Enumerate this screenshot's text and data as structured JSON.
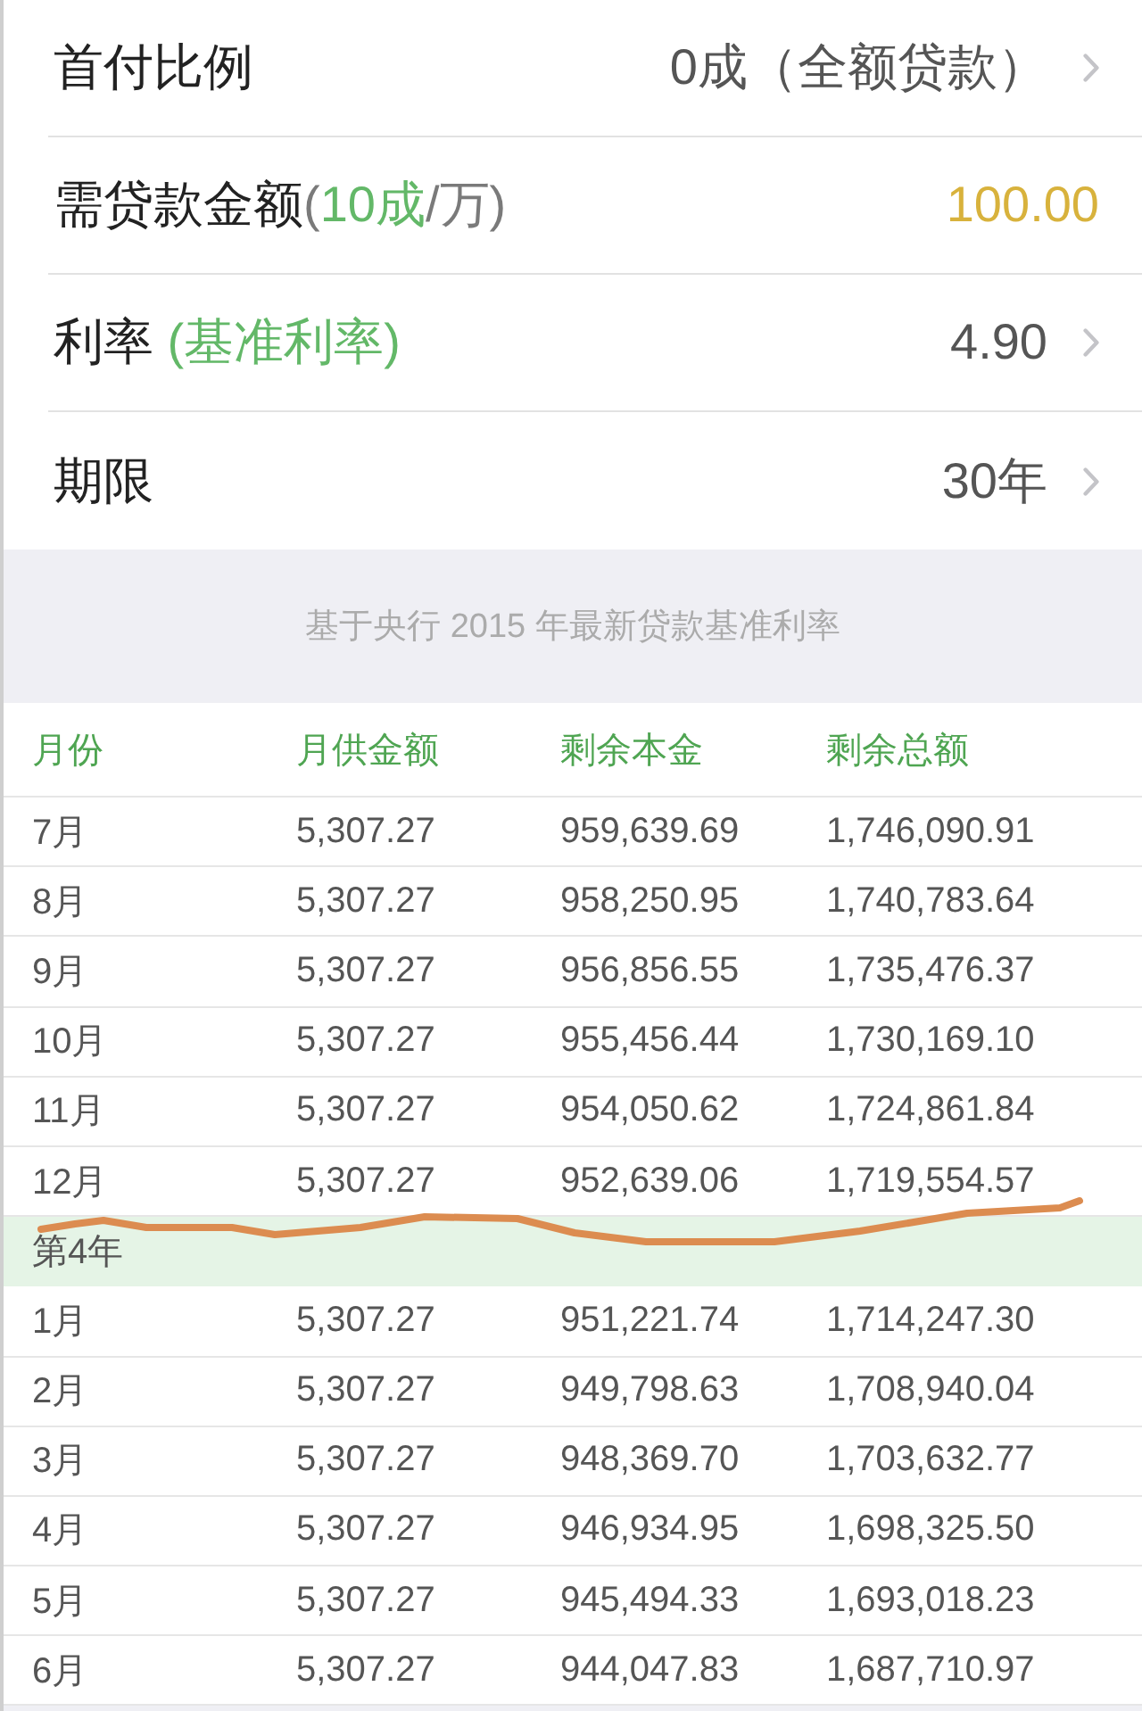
{
  "settings": [
    {
      "kind": "picker",
      "label": [
        {
          "text": "首付比例",
          "color": "#222222"
        }
      ],
      "value": "0成（全额贷款）"
    },
    {
      "kind": "computed",
      "label": [
        {
          "text": "需贷款金额",
          "color": "#222222"
        },
        {
          "text": "(",
          "color": "#7a7a7a"
        },
        {
          "text": "10成",
          "color": "#63b868"
        },
        {
          "text": "/万)",
          "color": "#7a7a7a"
        }
      ],
      "value": "100.00"
    },
    {
      "kind": "picker",
      "label": [
        {
          "text": "利率",
          "color": "#222222"
        },
        {
          "text": " (基准利率)",
          "color": "#63b868"
        }
      ],
      "value": "4.90"
    },
    {
      "kind": "picker",
      "label": [
        {
          "text": "期限",
          "color": "#222222"
        }
      ],
      "value": "30年"
    }
  ],
  "note": "基于央行 2015 年最新贷款基准利率",
  "schedule": {
    "columns": [
      "月份",
      "月供金额",
      "剩余本金",
      "剩余总额"
    ],
    "rows": [
      {
        "kind": "month",
        "cells": [
          "7月",
          "5,307.27",
          "959,639.69",
          "1,746,090.91"
        ]
      },
      {
        "kind": "month",
        "cells": [
          "8月",
          "5,307.27",
          "958,250.95",
          "1,740,783.64"
        ]
      },
      {
        "kind": "month",
        "cells": [
          "9月",
          "5,307.27",
          "956,856.55",
          "1,735,476.37"
        ]
      },
      {
        "kind": "month",
        "cells": [
          "10月",
          "5,307.27",
          "955,456.44",
          "1,730,169.10"
        ]
      },
      {
        "kind": "month",
        "cells": [
          "11月",
          "5,307.27",
          "954,050.62",
          "1,724,861.84"
        ]
      },
      {
        "kind": "month",
        "cells": [
          "12月",
          "5,307.27",
          "952,639.06",
          "1,719,554.57"
        ]
      },
      {
        "kind": "year",
        "label": "第4年"
      },
      {
        "kind": "month",
        "cells": [
          "1月",
          "5,307.27",
          "951,221.74",
          "1,714,247.30"
        ]
      },
      {
        "kind": "month",
        "cells": [
          "2月",
          "5,307.27",
          "949,798.63",
          "1,708,940.04"
        ]
      },
      {
        "kind": "month",
        "cells": [
          "3月",
          "5,307.27",
          "948,369.70",
          "1,703,632.77"
        ]
      },
      {
        "kind": "month",
        "cells": [
          "4月",
          "5,307.27",
          "946,934.95",
          "1,698,325.50"
        ]
      },
      {
        "kind": "month",
        "cells": [
          "5月",
          "5,307.27",
          "945,494.33",
          "1,693,018.23"
        ]
      },
      {
        "kind": "month",
        "cells": [
          "6月",
          "5,307.27",
          "944,047.83",
          "1,687,710.97"
        ]
      }
    ]
  }
}
